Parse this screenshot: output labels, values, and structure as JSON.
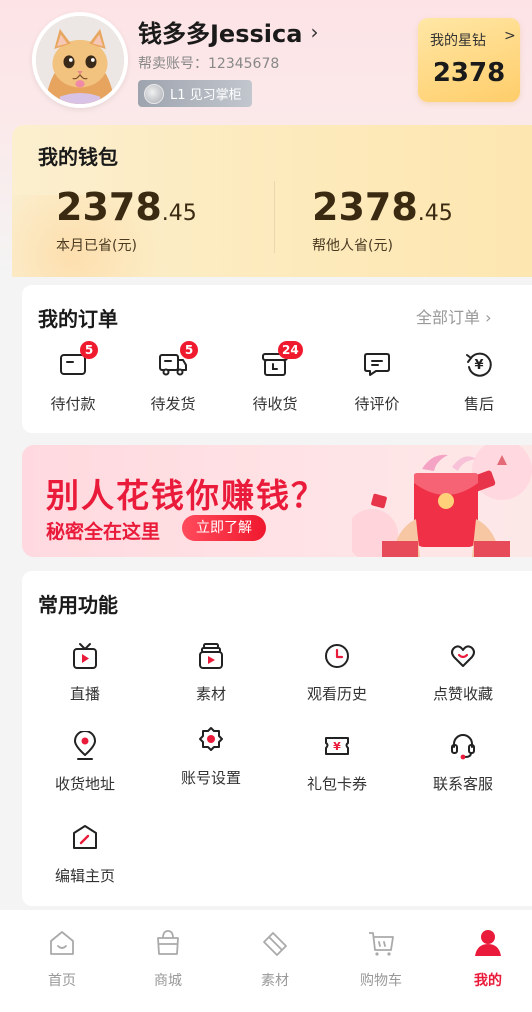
{
  "profile": {
    "name": "钱多多Jessica",
    "chevron": "›",
    "account": "帮卖账号：12345678",
    "level": "L1 见习掌柜",
    "star": {
      "title": "我的星钻",
      "chevron": ">",
      "value": "2378"
    }
  },
  "wallet": {
    "title": "我的钱包",
    "items": [
      {
        "int": "2378",
        "dec": ".45",
        "label": "本月已省(元)"
      },
      {
        "int": "2378",
        "dec": ".45",
        "label": "帮他人省(元)"
      }
    ]
  },
  "orders": {
    "title": "我的订单",
    "all": "全部订单 ›",
    "items": [
      {
        "label": "待付款",
        "badge": "5",
        "icon": "wallet-icon"
      },
      {
        "label": "待发货",
        "badge": "5",
        "icon": "truck-icon"
      },
      {
        "label": "待收货",
        "badge": "24",
        "icon": "package-icon"
      },
      {
        "label": "待评价",
        "badge": "",
        "icon": "comment-icon"
      },
      {
        "label": "售后",
        "badge": "",
        "icon": "refund-icon"
      }
    ]
  },
  "banner": {
    "title": "别人花钱你赚钱？",
    "subtitle": "秘密全在这里",
    "cta": "立即了解"
  },
  "functions": {
    "title": "常用功能",
    "items": [
      {
        "label": "直播",
        "icon": "live-tv-icon"
      },
      {
        "label": "素材",
        "icon": "material-icon"
      },
      {
        "label": "观看历史",
        "icon": "clock-icon"
      },
      {
        "label": "点赞收藏",
        "icon": "heart-icon"
      },
      {
        "label": "收货地址",
        "icon": "location-icon"
      },
      {
        "label": "账号设置",
        "icon": "settings-icon"
      },
      {
        "label": "礼包卡券",
        "icon": "coupon-icon"
      },
      {
        "label": "联系客服",
        "icon": "headset-icon"
      },
      {
        "label": "编辑主页",
        "icon": "edit-icon"
      }
    ]
  },
  "tabbar": {
    "items": [
      {
        "label": "首页",
        "icon": "home-icon",
        "active": false
      },
      {
        "label": "商城",
        "icon": "bag-icon",
        "active": false
      },
      {
        "label": "素材",
        "icon": "diamond-icon",
        "active": false
      },
      {
        "label": "购物车",
        "icon": "cart-icon",
        "active": false
      },
      {
        "label": "我的",
        "icon": "user-icon",
        "active": true
      }
    ]
  },
  "colors": {
    "accent": "#ea1b3a",
    "badge": "#f01a2e",
    "icon_dark": "#222222",
    "icon_red": "#ea1b3a",
    "tab_inactive": "#aaaaaa"
  }
}
